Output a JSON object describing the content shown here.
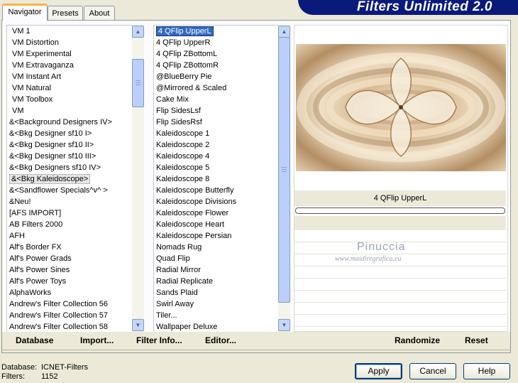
{
  "tabs": [
    {
      "label": "Navigator",
      "active": true
    },
    {
      "label": "Presets",
      "active": false
    },
    {
      "label": "About",
      "active": false
    }
  ],
  "app_title": "Filters Unlimited 2.0",
  "categories": [
    "VM 1",
    "VM Distortion",
    "VM Experimental",
    "VM Extravaganza",
    "VM Instant Art",
    "VM Natural",
    "VM Toolbox",
    "VM",
    "&<Background Designers IV>",
    "&<Bkg Designer sf10 I>",
    "&<Bkg Designer sf10 II>",
    "&<Bkg Designer sf10 III>",
    "&<Bkg Designers sf10 IV>",
    "&<Bkg Kaleidoscope>",
    "&<Sandflower Specials^v^ >",
    "&Neu!",
    "[AFS IMPORT]",
    "AB Filters 2000",
    "AFH",
    "Alf's Border FX",
    "Alf's Power Grads",
    "Alf's Power Sines",
    "Alf's Power Toys",
    "AlphaWorks",
    "Andrew's Filter Collection 56",
    "Andrew's Filter Collection 57",
    "Andrew's Filter Collection 58"
  ],
  "selected_category": "&<Bkg Kaleidoscope>",
  "filters": [
    "4 QFlip UpperL",
    "4 QFlip UpperR",
    "4 QFlip ZBottomL",
    "4 QFlip ZBottomR",
    "@BlueBerry Pie",
    "@Mirrored & Scaled",
    "Cake Mix",
    "Flip SidesLsf",
    "Flip SidesRsf",
    "Kaleidoscope 1",
    "Kaleidoscope 2",
    "Kaleidoscope 4",
    "Kaleidoscope 5",
    "Kaleidoscope 8",
    "Kaleidoscope Butterfly",
    "Kaleidoscope Divisions",
    "Kaleidoscope Flower",
    "Kaleidoscope Heart",
    "Kaleidoscope Persian",
    "Nomads Rug",
    "Quad Flip",
    "Radial Mirror",
    "Radial Replicate",
    "Sands Plaid",
    "Swirl Away",
    "Tiler...",
    "Wallpaper Deluxe"
  ],
  "selected_filter": "4 QFlip UpperL",
  "preview": {
    "filter_name": "4 QFlip UpperL",
    "watermark_title": "Pinuccia",
    "watermark_url": "www.maidiregrafica.eu"
  },
  "bottom_links": {
    "database": "Database",
    "import": "Import...",
    "filter_info": "Filter Info...",
    "editor": "Editor...",
    "randomize": "Randomize",
    "reset": "Reset"
  },
  "status": {
    "database_label": "Database:",
    "database_value": "ICNET-Filters",
    "filters_label": "Filters:",
    "filters_value": "1152"
  },
  "buttons": {
    "apply": "Apply",
    "cancel": "Cancel",
    "help": "Help"
  },
  "colors": {
    "banner": "#0a1a7a",
    "selection": "#316ac5",
    "tab_accent": "#f9b33f"
  }
}
